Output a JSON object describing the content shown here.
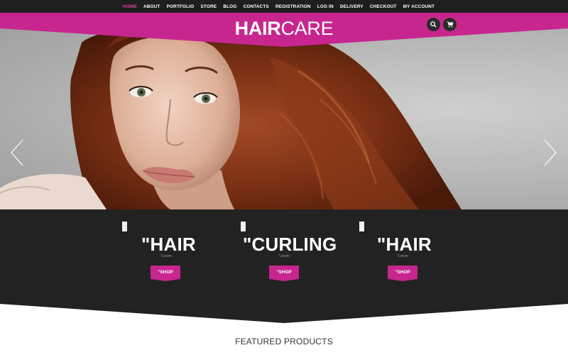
{
  "nav": {
    "items": [
      {
        "label": "HOME",
        "active": true
      },
      {
        "label": "ABOUT"
      },
      {
        "label": "PORTFOLIO"
      },
      {
        "label": "STORE"
      },
      {
        "label": "BLOG"
      },
      {
        "label": "CONTACTS"
      },
      {
        "label": "REGISTRATION"
      },
      {
        "label": "LOG IN"
      },
      {
        "label": "DELIVERY"
      },
      {
        "label": "CHECKOUT"
      },
      {
        "label": "MY ACCOUNT"
      }
    ]
  },
  "header": {
    "logo_bold": "HAIR",
    "logo_light": "CARE",
    "icons": [
      "search-icon",
      "cart-icon"
    ]
  },
  "slider": {
    "prev_icon": "chevron-left-icon",
    "next_icon": "chevron-right-icon"
  },
  "banners": [
    {
      "title": "\"HAIR",
      "subtitle": "\"Lorem",
      "button": "\"SHOP"
    },
    {
      "title": "\"CURLING",
      "subtitle": "\"Lorem",
      "button": "\"SHOP"
    },
    {
      "title": "\"HAIR",
      "subtitle": "\"Lorem",
      "button": "\"SHOP"
    }
  ],
  "featured": {
    "title": "FEATURED PRODUCTS"
  },
  "colors": {
    "accent": "#c7268f",
    "nav_active": "#d6409b",
    "dark": "#222222",
    "nav_bg": "#1e1e1e"
  }
}
